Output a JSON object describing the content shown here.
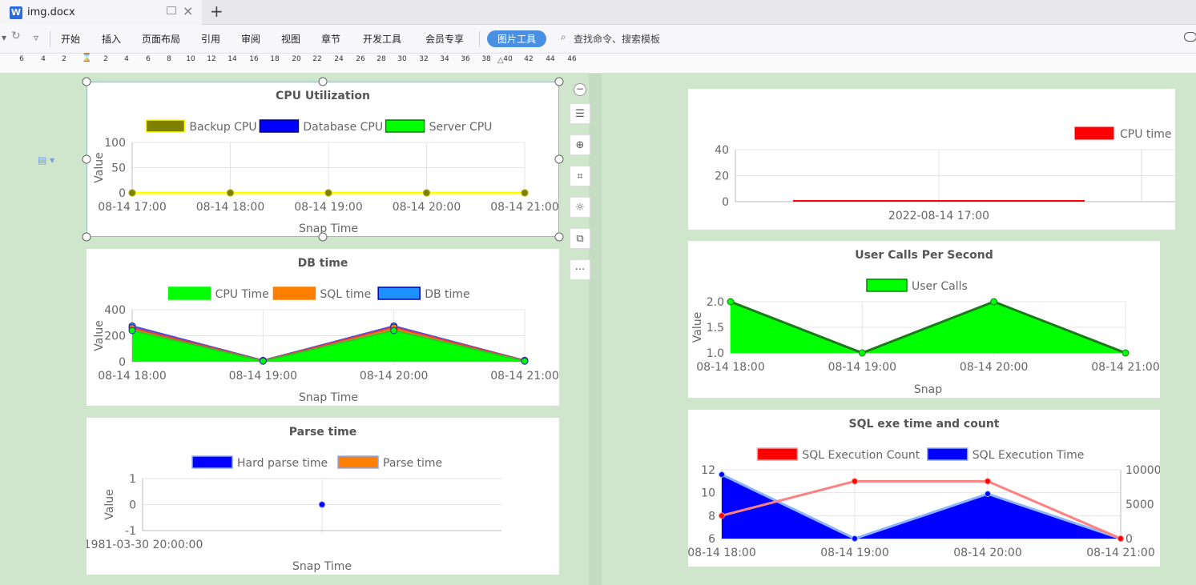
{
  "window": {
    "tab_title": "img.docx",
    "doc_icon": "W",
    "new_tab": "+",
    "close": "×"
  },
  "menubar": {
    "items": [
      "开始",
      "插入",
      "页面布局",
      "引用",
      "审阅",
      "视图",
      "章节",
      "开发工具",
      "会员专享"
    ],
    "active_tool": "图片工具",
    "search": "查找命令、搜索模板"
  },
  "ruler": {
    "ticks": [
      "6",
      "4",
      "2",
      "",
      "2",
      "4",
      "6",
      "8",
      "10",
      "12",
      "14",
      "16",
      "18",
      "20",
      "22",
      "24",
      "26",
      "28",
      "30",
      "32",
      "34",
      "36",
      "38",
      "40",
      "42",
      "44",
      "46"
    ]
  },
  "side_toolbar": {
    "more": "···"
  },
  "colors": {
    "green": "#00ff00",
    "olive": "#808000",
    "blue": "#0000ff",
    "red": "#ff0000",
    "orange": "#ff7f00",
    "lightblue": "#1e90ff",
    "accent": "#4a90e2"
  },
  "chart_data": [
    {
      "id": "cpu-util",
      "type": "line",
      "title": "CPU Utilization",
      "xlabel": "Snap Time",
      "ylabel": "Value",
      "categories": [
        "08-14 17:00",
        "08-14 18:00",
        "08-14 19:00",
        "08-14 20:00",
        "08-14 21:00"
      ],
      "yticks": [
        "100",
        "50",
        "0"
      ],
      "ylim": [
        0,
        100
      ],
      "series": [
        {
          "name": "Backup CPU",
          "values": [
            0,
            0,
            0,
            0,
            0
          ],
          "color": "#808000",
          "border": "#ffff00"
        },
        {
          "name": "Database CPU",
          "values": [
            0,
            0,
            0,
            0,
            0
          ],
          "color": "#0000ff",
          "border": "#000080"
        },
        {
          "name": "Server CPU",
          "values": [
            0,
            0,
            0,
            0,
            0
          ],
          "color": "#00ff00",
          "border": "#008000"
        }
      ]
    },
    {
      "id": "db-time",
      "type": "area",
      "title": "DB time",
      "xlabel": "Snap Time",
      "ylabel": "Value",
      "categories": [
        "08-14 18:00",
        "08-14 19:00",
        "08-14 20:00",
        "08-14 21:00"
      ],
      "yticks": [
        "400",
        "200",
        "0"
      ],
      "ylim": [
        0,
        400
      ],
      "series": [
        {
          "name": "CPU Time",
          "values": [
            240,
            5,
            240,
            5
          ],
          "color": "#00ff00"
        },
        {
          "name": "SQL time",
          "values": [
            260,
            8,
            265,
            8
          ],
          "color": "#ff7f00"
        },
        {
          "name": "DB time",
          "values": [
            275,
            10,
            275,
            10
          ],
          "color": "#1e90ff"
        }
      ]
    },
    {
      "id": "parse-time",
      "type": "scatter",
      "title": "Parse time",
      "xlabel": "Snap Time",
      "ylabel": "Value",
      "categories": [
        "1981-03-30 20:00:00"
      ],
      "yticks": [
        "1",
        "0",
        "-1"
      ],
      "ylim": [
        -1,
        1
      ],
      "series": [
        {
          "name": "Hard parse time",
          "values": [
            0
          ],
          "color": "#0000ff"
        },
        {
          "name": "Parse time",
          "values": [],
          "color": "#ff7f00"
        }
      ]
    },
    {
      "id": "cpu-time",
      "type": "line",
      "title": "",
      "xlabel": "",
      "ylabel": "",
      "categories": [
        "2022-08-14 17:00"
      ],
      "yticks": [
        "40",
        "20",
        "0"
      ],
      "ylim": [
        0,
        40
      ],
      "series": [
        {
          "name": "CPU time",
          "values": [
            0
          ],
          "color": "#ff0000"
        }
      ]
    },
    {
      "id": "user-calls",
      "type": "area",
      "title": "User Calls Per Second",
      "xlabel": "Snap",
      "ylabel": "Value",
      "categories": [
        "08-14 18:00",
        "08-14 19:00",
        "08-14 20:00",
        "08-14 21:00"
      ],
      "yticks": [
        "2.0",
        "1.5",
        "1.0"
      ],
      "ylim": [
        1,
        2
      ],
      "series": [
        {
          "name": "User Calls",
          "values": [
            2.0,
            1.0,
            2.0,
            1.0
          ],
          "color": "#00ff00"
        }
      ]
    },
    {
      "id": "sql-exe",
      "type": "line",
      "title": "SQL exe time and count",
      "xlabel": "",
      "ylabel": "",
      "categories": [
        "08-14 18:00",
        "08-14 19:00",
        "08-14 20:00",
        "08-14 21:00"
      ],
      "yticks": [
        "12",
        "10",
        "8",
        "6"
      ],
      "y2ticks": [
        "10000",
        "5000",
        "0"
      ],
      "ylim": [
        6,
        12
      ],
      "y2lim": [
        0,
        10000
      ],
      "series": [
        {
          "name": "SQL Execution Count",
          "values": [
            8,
            11,
            11,
            6
          ],
          "color": "#ff0000",
          "axis": "left"
        },
        {
          "name": "SQL Execution Time",
          "values": [
            9300,
            0,
            6500,
            0
          ],
          "color": "#0000ff",
          "axis": "right"
        }
      ]
    }
  ]
}
